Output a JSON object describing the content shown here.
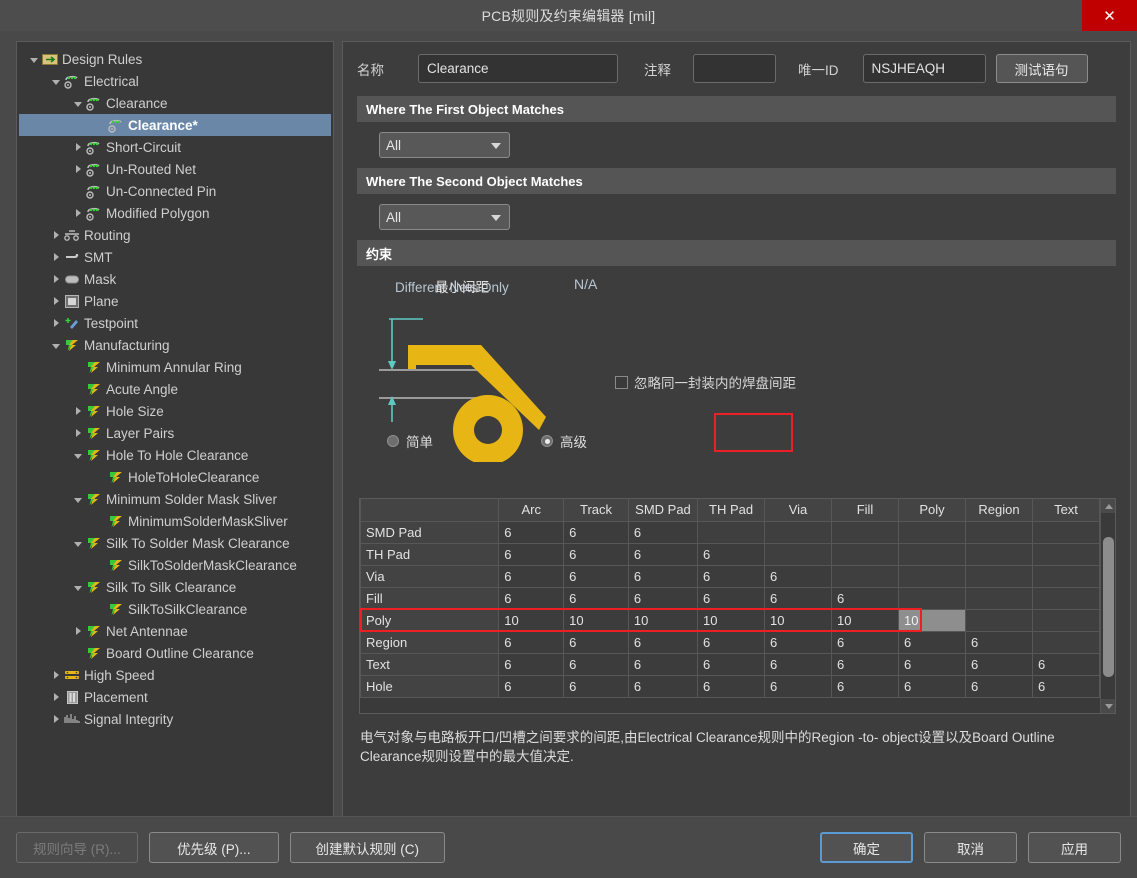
{
  "window": {
    "title": "PCB规则及约束编辑器 [mil]",
    "close_label": "✕"
  },
  "tree": {
    "items": [
      {
        "label": "Design Rules",
        "depth": 0,
        "toggle": "open",
        "icon": "folder-rules-icon",
        "selected": false
      },
      {
        "label": "Electrical",
        "depth": 1,
        "toggle": "open",
        "icon": "electrical-icon",
        "selected": false
      },
      {
        "label": "Clearance",
        "depth": 2,
        "toggle": "open",
        "icon": "electrical-icon",
        "selected": false
      },
      {
        "label": "Clearance*",
        "depth": 3,
        "toggle": "none",
        "icon": "electrical-icon",
        "selected": true
      },
      {
        "label": "Short-Circuit",
        "depth": 2,
        "toggle": "closed",
        "icon": "electrical-icon",
        "selected": false
      },
      {
        "label": "Un-Routed Net",
        "depth": 2,
        "toggle": "closed",
        "icon": "electrical-icon",
        "selected": false
      },
      {
        "label": "Un-Connected Pin",
        "depth": 2,
        "toggle": "none",
        "icon": "electrical-icon",
        "selected": false
      },
      {
        "label": "Modified Polygon",
        "depth": 2,
        "toggle": "closed",
        "icon": "electrical-icon",
        "selected": false
      },
      {
        "label": "Routing",
        "depth": 1,
        "toggle": "closed",
        "icon": "routing-icon",
        "selected": false
      },
      {
        "label": "SMT",
        "depth": 1,
        "toggle": "closed",
        "icon": "smt-icon",
        "selected": false
      },
      {
        "label": "Mask",
        "depth": 1,
        "toggle": "closed",
        "icon": "mask-icon",
        "selected": false
      },
      {
        "label": "Plane",
        "depth": 1,
        "toggle": "closed",
        "icon": "plane-icon",
        "selected": false
      },
      {
        "label": "Testpoint",
        "depth": 1,
        "toggle": "closed",
        "icon": "testpoint-icon",
        "selected": false
      },
      {
        "label": "Manufacturing",
        "depth": 1,
        "toggle": "open",
        "icon": "manufacturing-icon",
        "selected": false
      },
      {
        "label": "Minimum Annular Ring",
        "depth": 2,
        "toggle": "none",
        "icon": "manufacturing-icon",
        "selected": false
      },
      {
        "label": "Acute Angle",
        "depth": 2,
        "toggle": "none",
        "icon": "manufacturing-icon",
        "selected": false
      },
      {
        "label": "Hole Size",
        "depth": 2,
        "toggle": "closed",
        "icon": "manufacturing-icon",
        "selected": false
      },
      {
        "label": "Layer Pairs",
        "depth": 2,
        "toggle": "closed",
        "icon": "manufacturing-icon",
        "selected": false
      },
      {
        "label": "Hole To Hole Clearance",
        "depth": 2,
        "toggle": "open",
        "icon": "manufacturing-icon",
        "selected": false
      },
      {
        "label": "HoleToHoleClearance",
        "depth": 3,
        "toggle": "none",
        "icon": "manufacturing-icon",
        "selected": false
      },
      {
        "label": "Minimum Solder Mask Sliver",
        "depth": 2,
        "toggle": "open",
        "icon": "manufacturing-icon",
        "selected": false
      },
      {
        "label": "MinimumSolderMaskSliver",
        "depth": 3,
        "toggle": "none",
        "icon": "manufacturing-icon",
        "selected": false
      },
      {
        "label": "Silk To Solder Mask Clearance",
        "depth": 2,
        "toggle": "open",
        "icon": "manufacturing-icon",
        "selected": false
      },
      {
        "label": "SilkToSolderMaskClearance",
        "depth": 3,
        "toggle": "none",
        "icon": "manufacturing-icon",
        "selected": false
      },
      {
        "label": "Silk To Silk Clearance",
        "depth": 2,
        "toggle": "open",
        "icon": "manufacturing-icon",
        "selected": false
      },
      {
        "label": "SilkToSilkClearance",
        "depth": 3,
        "toggle": "none",
        "icon": "manufacturing-icon",
        "selected": false
      },
      {
        "label": "Net Antennae",
        "depth": 2,
        "toggle": "closed",
        "icon": "manufacturing-icon",
        "selected": false
      },
      {
        "label": "Board Outline Clearance",
        "depth": 2,
        "toggle": "none",
        "icon": "manufacturing-icon",
        "selected": false
      },
      {
        "label": "High Speed",
        "depth": 1,
        "toggle": "closed",
        "icon": "highspeed-icon",
        "selected": false
      },
      {
        "label": "Placement",
        "depth": 1,
        "toggle": "closed",
        "icon": "placement-icon",
        "selected": false
      },
      {
        "label": "Signal Integrity",
        "depth": 1,
        "toggle": "closed",
        "icon": "signal-icon",
        "selected": false
      }
    ]
  },
  "form": {
    "name_label": "名称",
    "name_value": "Clearance",
    "comment_label": "注释",
    "comment_value": "",
    "uniqueid_label": "唯一ID",
    "uniqueid_value": "NSJHEAQH",
    "test_button": "测试语句"
  },
  "sections": {
    "first_object": "Where The First Object Matches",
    "second_object": "Where The Second Object Matches",
    "constraints": "约束"
  },
  "selectors": {
    "first_value": "All",
    "second_value": "All"
  },
  "constraint": {
    "different_nets_only": "Different Nets Only",
    "min_clearance_label": "最小间距",
    "na_text": "N/A",
    "ignore_checkbox_label": "忽略同一封装内的焊盘间距",
    "ignore_checked": false,
    "mode_simple": "简单",
    "mode_advanced": "高级",
    "mode_selected": "高级",
    "highlight_color": "#ec2024"
  },
  "table": {
    "columns": [
      "",
      "Arc",
      "Track",
      "SMD Pad",
      "TH Pad",
      "Via",
      "Fill",
      "Poly",
      "Region",
      "Text"
    ],
    "rows": [
      {
        "header": "SMD Pad",
        "values": [
          "6",
          "6",
          "6",
          "",
          "",
          "",
          "",
          "",
          ""
        ]
      },
      {
        "header": "TH Pad",
        "values": [
          "6",
          "6",
          "6",
          "6",
          "",
          "",
          "",
          "",
          ""
        ]
      },
      {
        "header": "Via",
        "values": [
          "6",
          "6",
          "6",
          "6",
          "6",
          "",
          "",
          "",
          ""
        ]
      },
      {
        "header": "Fill",
        "values": [
          "6",
          "6",
          "6",
          "6",
          "6",
          "6",
          "",
          "",
          ""
        ]
      },
      {
        "header": "Poly",
        "values": [
          "10",
          "10",
          "10",
          "10",
          "10",
          "10",
          "10",
          "",
          ""
        ],
        "highlighted": true,
        "selected_col": 7
      },
      {
        "header": "Region",
        "values": [
          "6",
          "6",
          "6",
          "6",
          "6",
          "6",
          "6",
          "6",
          ""
        ]
      },
      {
        "header": "Text",
        "values": [
          "6",
          "6",
          "6",
          "6",
          "6",
          "6",
          "6",
          "6",
          "6"
        ]
      },
      {
        "header": "Hole",
        "values": [
          "6",
          "6",
          "6",
          "6",
          "6",
          "6",
          "6",
          "6",
          "6"
        ]
      }
    ]
  },
  "description": "电气对象与电路板开口/凹槽之间要求的间距,由Electrical Clearance规则中的Region -to- object设置以及Board Outline Clearance规则设置中的最大值决定.",
  "footer": {
    "wizard": "规则向导 (R)...",
    "priority": "优先级 (P)...",
    "create_default": "创建默认规则 (C)",
    "ok": "确定",
    "cancel": "取消",
    "apply": "应用"
  }
}
